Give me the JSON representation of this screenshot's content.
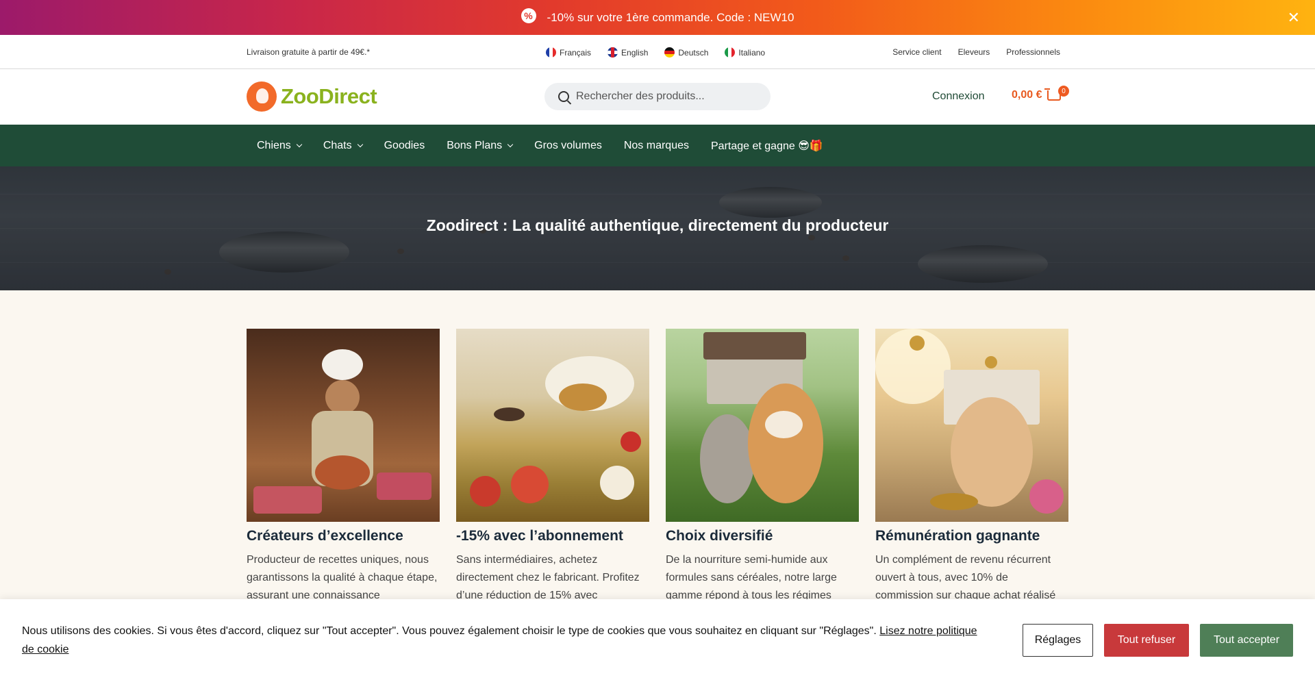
{
  "promo": {
    "icon": "percent-badge-icon",
    "text": "-10% sur votre 1ère commande.  Code : NEW10",
    "close": "✕"
  },
  "utility": {
    "shipping": "Livraison gratuite à partir de 49€.*",
    "languages": [
      "Français",
      "English",
      "Deutsch",
      "Italiano"
    ],
    "links": [
      "Service client",
      "Eleveurs",
      "Professionnels"
    ]
  },
  "header": {
    "logo": "ZooDirect",
    "search_placeholder": "Rechercher des produits...",
    "login": "Connexion",
    "cart_total": "0,00 €",
    "cart_count": "0"
  },
  "nav": {
    "items": [
      "Chiens",
      "Chats",
      "Goodies",
      "Bons Plans",
      "Gros volumes",
      "Nos marques",
      "Partage et gagne 😎🎁"
    ]
  },
  "hero": {
    "title": "Zoodirect : La qualité authentique, directement du producteur"
  },
  "features": [
    {
      "title": "Créateurs d’excellence",
      "text": "Producteur de recettes uniques, nous garantissons la qualité à chaque étape, assurant une connaissance"
    },
    {
      "title": "-15% avec l’abonnement",
      "text": "Sans intermédiaires, achetez directement chez le fabricant. Profitez d’une réduction de 15% avec"
    },
    {
      "title": "Choix diversifié",
      "text": "De la nourriture semi-humide aux formules sans céréales, notre large gamme répond à tous les régimes"
    },
    {
      "title": "Rémunération gagnante",
      "text": "Un complément de revenu récurrent ouvert à tous, avec 10% de commission sur chaque achat réalisé"
    }
  ],
  "cookie": {
    "text": "Nous utilisons des cookies. Si vous êtes d'accord, cliquez sur \"Tout accepter\". Vous pouvez également choisir le type de cookies que vous souhaitez en cliquant sur \"Réglages\". ",
    "link": "Lisez notre politique de cookie",
    "settings": "Réglages",
    "refuse": "Tout refuser",
    "accept": "Tout accepter"
  }
}
